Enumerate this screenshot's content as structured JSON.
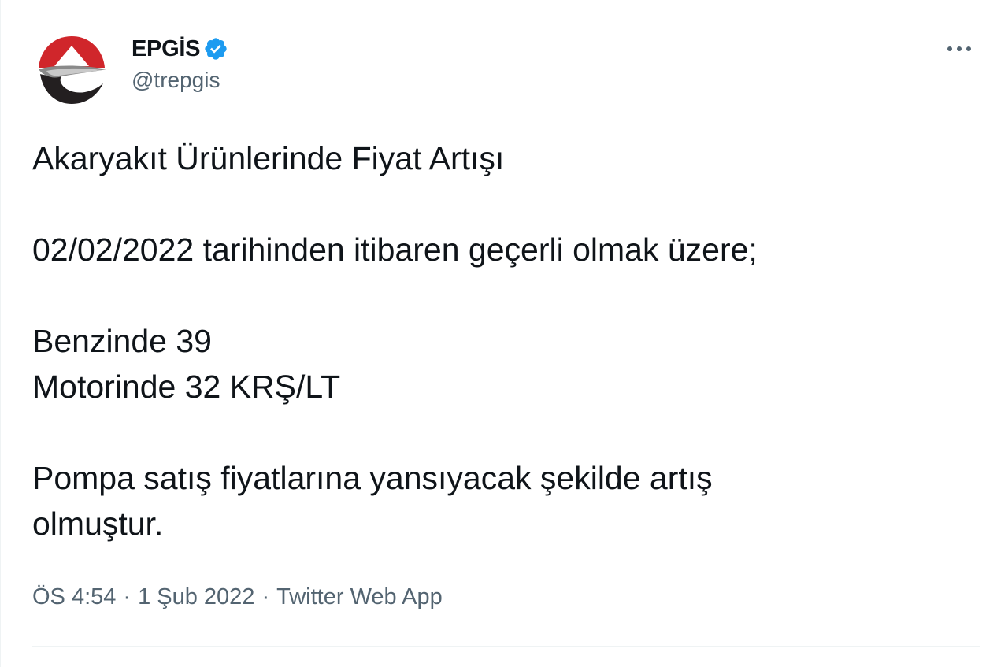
{
  "author": {
    "display_name": "EPGİS",
    "handle": "@trepgis",
    "verified": true
  },
  "icons": {
    "avatar": "epgis-logo",
    "verified": "verified-badge-icon",
    "more": "more-options-icon"
  },
  "colors": {
    "text": "#0f1419",
    "secondary": "#536471",
    "verified_blue": "#1d9bf0",
    "logo_red": "#d0262b",
    "logo_dark": "#231f20"
  },
  "tweet": {
    "line1": "Akaryakıt Ürünlerinde Fiyat Artışı",
    "line2": "02/02/2022 tarihinden itibaren geçerli olmak üzere;",
    "line3": "Benzinde 39",
    "line4": "Motorinde 32 KRŞ/LT",
    "line5": "Pompa satış fiyatlarına yansıyacak şekilde artış",
    "line6": "olmuştur."
  },
  "meta": {
    "time": "ÖS 4:54",
    "separator": "·",
    "date": "1 Şub 2022",
    "source": "Twitter Web App"
  }
}
